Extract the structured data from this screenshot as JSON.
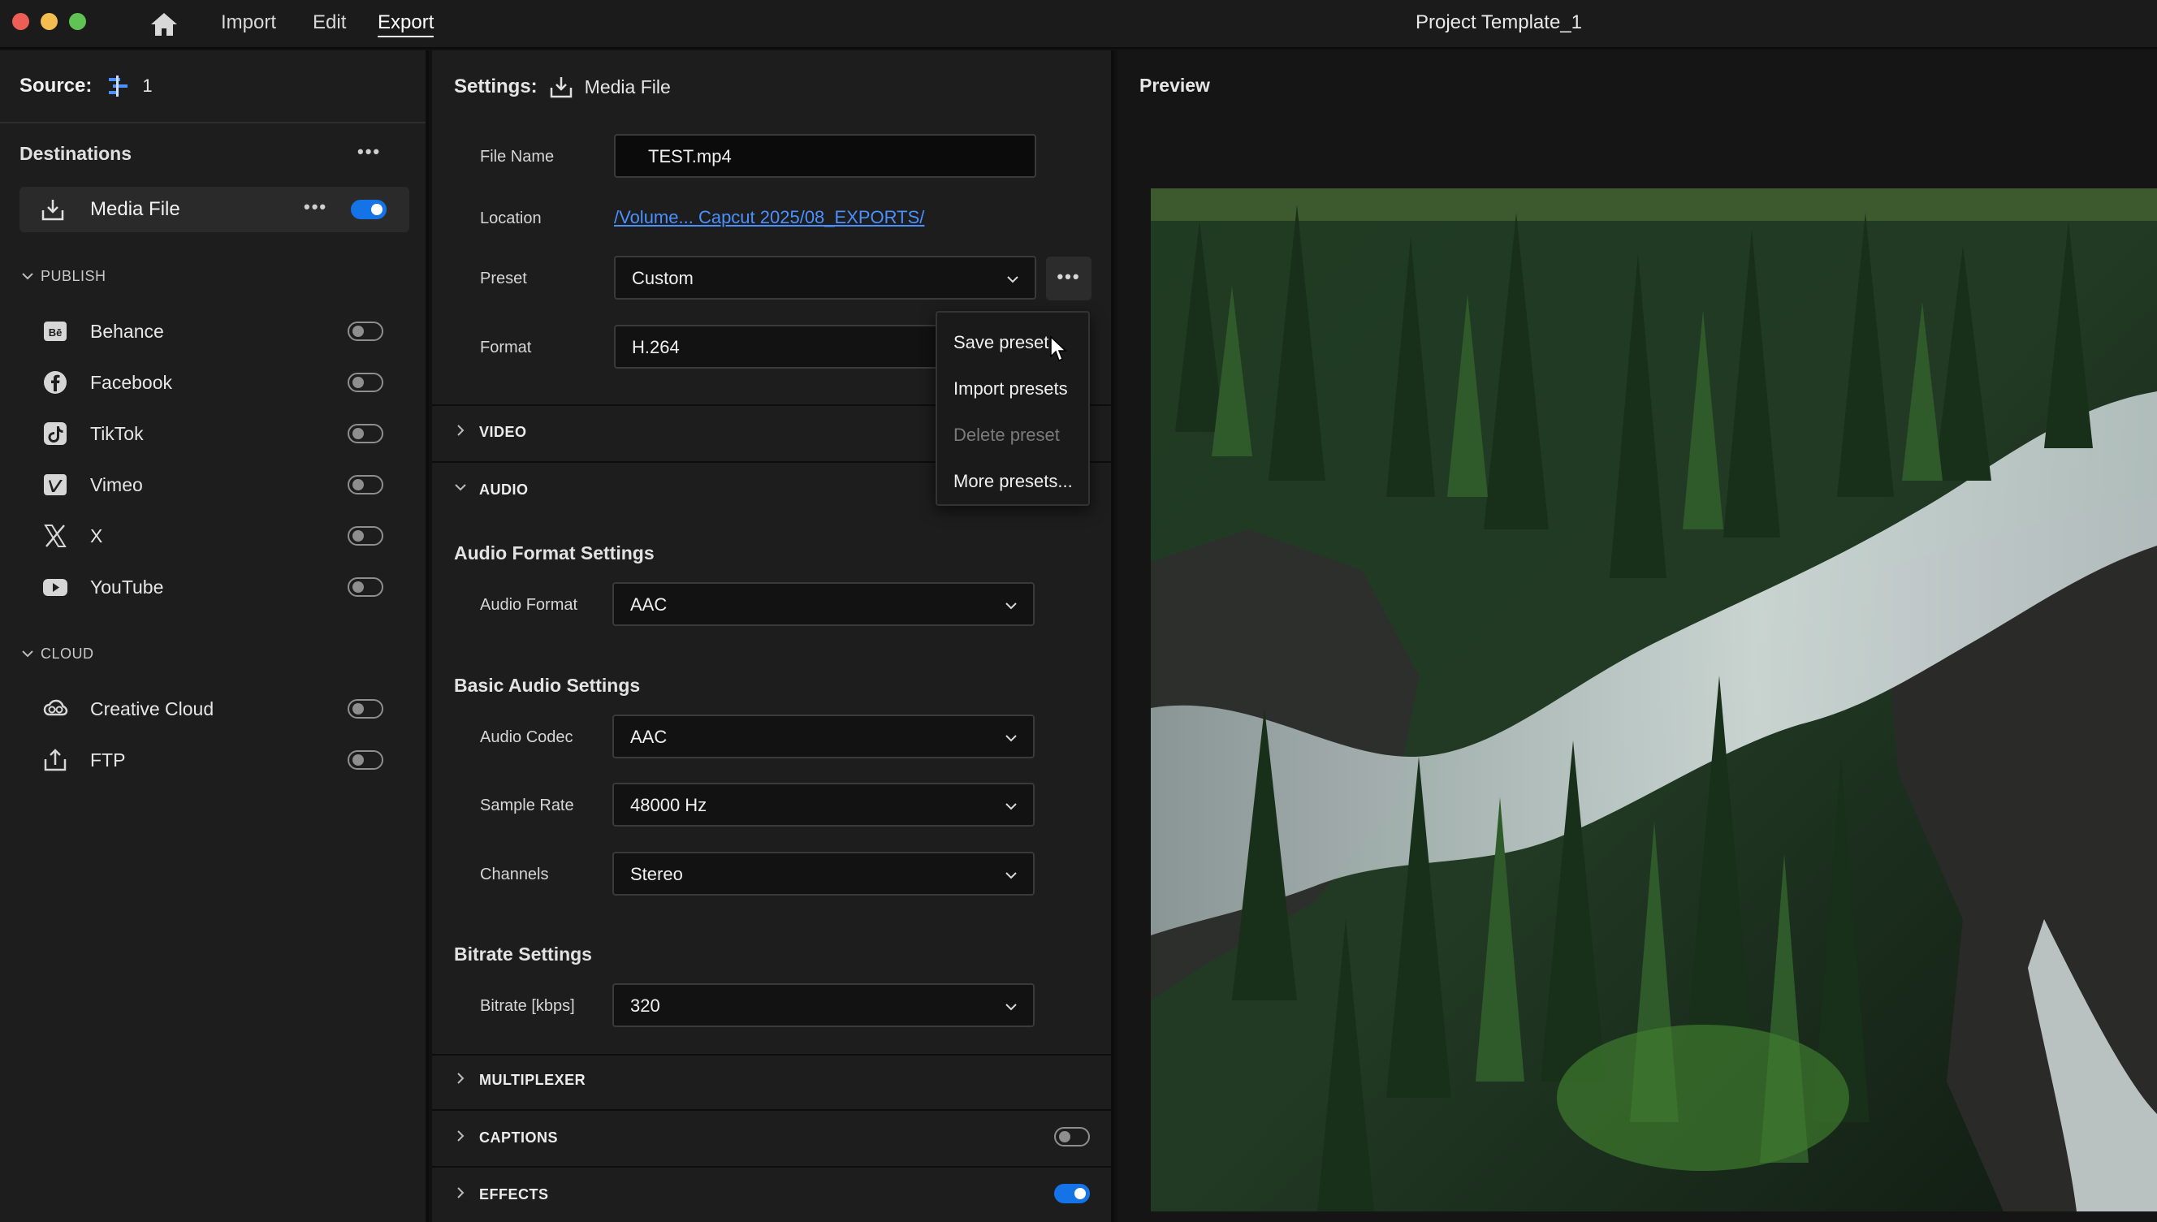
{
  "window": {
    "title": "Project Template_1",
    "menu": [
      "Import",
      "Edit",
      "Export"
    ],
    "active_menu": "Export"
  },
  "source": {
    "label": "Source:",
    "count": "1"
  },
  "destinations": {
    "header": "Destinations",
    "media_file": {
      "label": "Media File",
      "enabled": true
    },
    "publish_group": "PUBLISH",
    "publish": [
      {
        "name": "Behance",
        "icon": "behance-icon",
        "enabled": false
      },
      {
        "name": "Facebook",
        "icon": "facebook-icon",
        "enabled": false
      },
      {
        "name": "TikTok",
        "icon": "tiktok-icon",
        "enabled": false
      },
      {
        "name": "Vimeo",
        "icon": "vimeo-icon",
        "enabled": false
      },
      {
        "name": "X",
        "icon": "x-icon",
        "enabled": false
      },
      {
        "name": "YouTube",
        "icon": "youtube-icon",
        "enabled": false
      }
    ],
    "cloud_group": "CLOUD",
    "cloud": [
      {
        "name": "Creative Cloud",
        "icon": "creative-cloud-icon",
        "enabled": false
      },
      {
        "name": "FTP",
        "icon": "ftp-upload-icon",
        "enabled": false
      }
    ]
  },
  "settings": {
    "label": "Settings:",
    "target": "Media File",
    "file_name_label": "File Name",
    "file_name": "TEST.mp4",
    "location_label": "Location",
    "location": "/Volume... Capcut 2025/08_EXPORTS/",
    "preset_label": "Preset",
    "preset": "Custom",
    "format_label": "Format",
    "format": "H.264",
    "sections": {
      "video": "VIDEO",
      "audio": "AUDIO",
      "multiplexer": "MULTIPLEXER",
      "captions": "CAPTIONS",
      "effects": "EFFECTS"
    },
    "captions_enabled": false,
    "effects_enabled": true,
    "audio": {
      "format_settings_head": "Audio Format Settings",
      "audio_format_label": "Audio Format",
      "audio_format": "AAC",
      "basic_head": "Basic Audio Settings",
      "codec_label": "Audio Codec",
      "codec": "AAC",
      "sample_rate_label": "Sample Rate",
      "sample_rate": "48000 Hz",
      "channels_label": "Channels",
      "channels": "Stereo",
      "bitrate_head": "Bitrate Settings",
      "bitrate_label": "Bitrate [kbps]",
      "bitrate": "320"
    }
  },
  "preset_menu": {
    "items": [
      "Save preset",
      "Import presets",
      "Delete preset",
      "More presets..."
    ],
    "disabled": [
      "Delete preset"
    ]
  },
  "preview": {
    "label": "Preview"
  },
  "colors": {
    "accent": "#1473e6",
    "link": "#4a90ff"
  }
}
